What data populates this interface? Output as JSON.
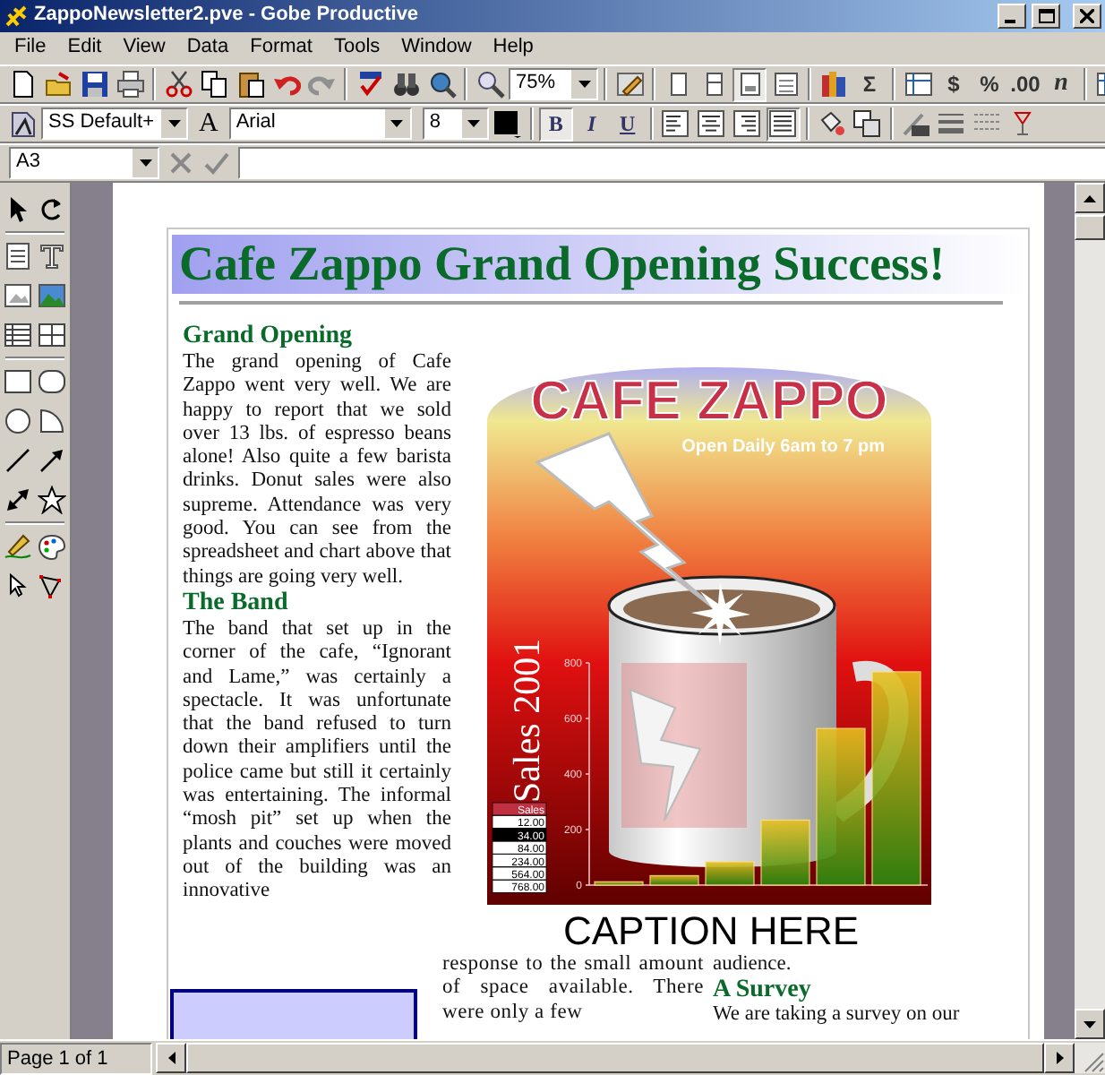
{
  "window": {
    "title": "ZappoNewsletter2.pve - Gobe Productive"
  },
  "menu": [
    {
      "label": "File"
    },
    {
      "label": "Edit"
    },
    {
      "label": "View"
    },
    {
      "label": "Data"
    },
    {
      "label": "Format"
    },
    {
      "label": "Tools"
    },
    {
      "label": "Window"
    },
    {
      "label": "Help"
    }
  ],
  "toolbar": {
    "zoom": "75%",
    "page_views": [
      {
        "selected": false
      },
      {
        "selected": false
      },
      {
        "selected": true
      },
      {
        "selected": false
      }
    ],
    "symbols": [
      "Σ",
      "$",
      "%",
      ".00",
      "n"
    ]
  },
  "format_bar": {
    "style": "SS Default+",
    "font_letter": "A",
    "font": "Arial",
    "size": "8",
    "styles": [
      {
        "label": "B",
        "pressed": true
      },
      {
        "label": "I",
        "pressed": false
      },
      {
        "label": "U",
        "pressed": false
      }
    ],
    "alignments": [
      {
        "kind": "left",
        "selected": false
      },
      {
        "kind": "center",
        "selected": false
      },
      {
        "kind": "right",
        "selected": false
      },
      {
        "kind": "justify",
        "selected": true
      }
    ]
  },
  "formula_bar": {
    "cell": "A3"
  },
  "article": {
    "headline": "Cafe Zappo Grand Opening Success!",
    "column_1": [
      {
        "kind": "heading",
        "text": "Grand Opening"
      },
      {
        "kind": "paragraph",
        "text": "The grand opening of Cafe Zappo went very well.  We are happy to report that we sold over 13 lbs. of espresso beans alone!  Also quite a few barista drinks.  Donut sales were also supreme. Attendance was very good. You can see from the spreadsheet and chart above that things are going very well."
      },
      {
        "kind": "heading",
        "text": "The Band"
      },
      {
        "kind": "paragraph",
        "text": "The band that set up in the corner of the cafe, “Ignorant and Lame,” was certainly a spectacle.  It was unfortunate that the band refused to turn down their amplifiers until the police came but still it certainly was entertaining. The informal “mosh pit” set up when the plants and couches were moved out of the building was an innovative"
      }
    ],
    "column_2": [
      {
        "kind": "paragraph",
        "text": "response to the small amount of space available. There were only a few"
      }
    ],
    "column_3": [
      {
        "kind": "paragraph",
        "text": "audience."
      },
      {
        "kind": "heading",
        "text": "A Survey"
      },
      {
        "kind": "paragraph",
        "text": "We are taking a survey on our"
      }
    ]
  },
  "poster": {
    "title": "CAFE ZAPPO",
    "subtitle": "Open Daily 6am to 7 pm",
    "side_label": "Sales 2001",
    "table": {
      "header": "Sales",
      "rows": [
        "12.00",
        "34.00",
        "84.00",
        "234.00",
        "564.00",
        "768.00"
      ]
    },
    "chart_data": {
      "type": "bar",
      "values": [
        12,
        34,
        84,
        234,
        564,
        768
      ],
      "ylim": [
        0,
        800
      ],
      "yticks": [
        0,
        200,
        400,
        600,
        800
      ]
    }
  },
  "caption": "CAPTION HERE",
  "status_bar": {
    "page": "Page 1 of 1"
  }
}
